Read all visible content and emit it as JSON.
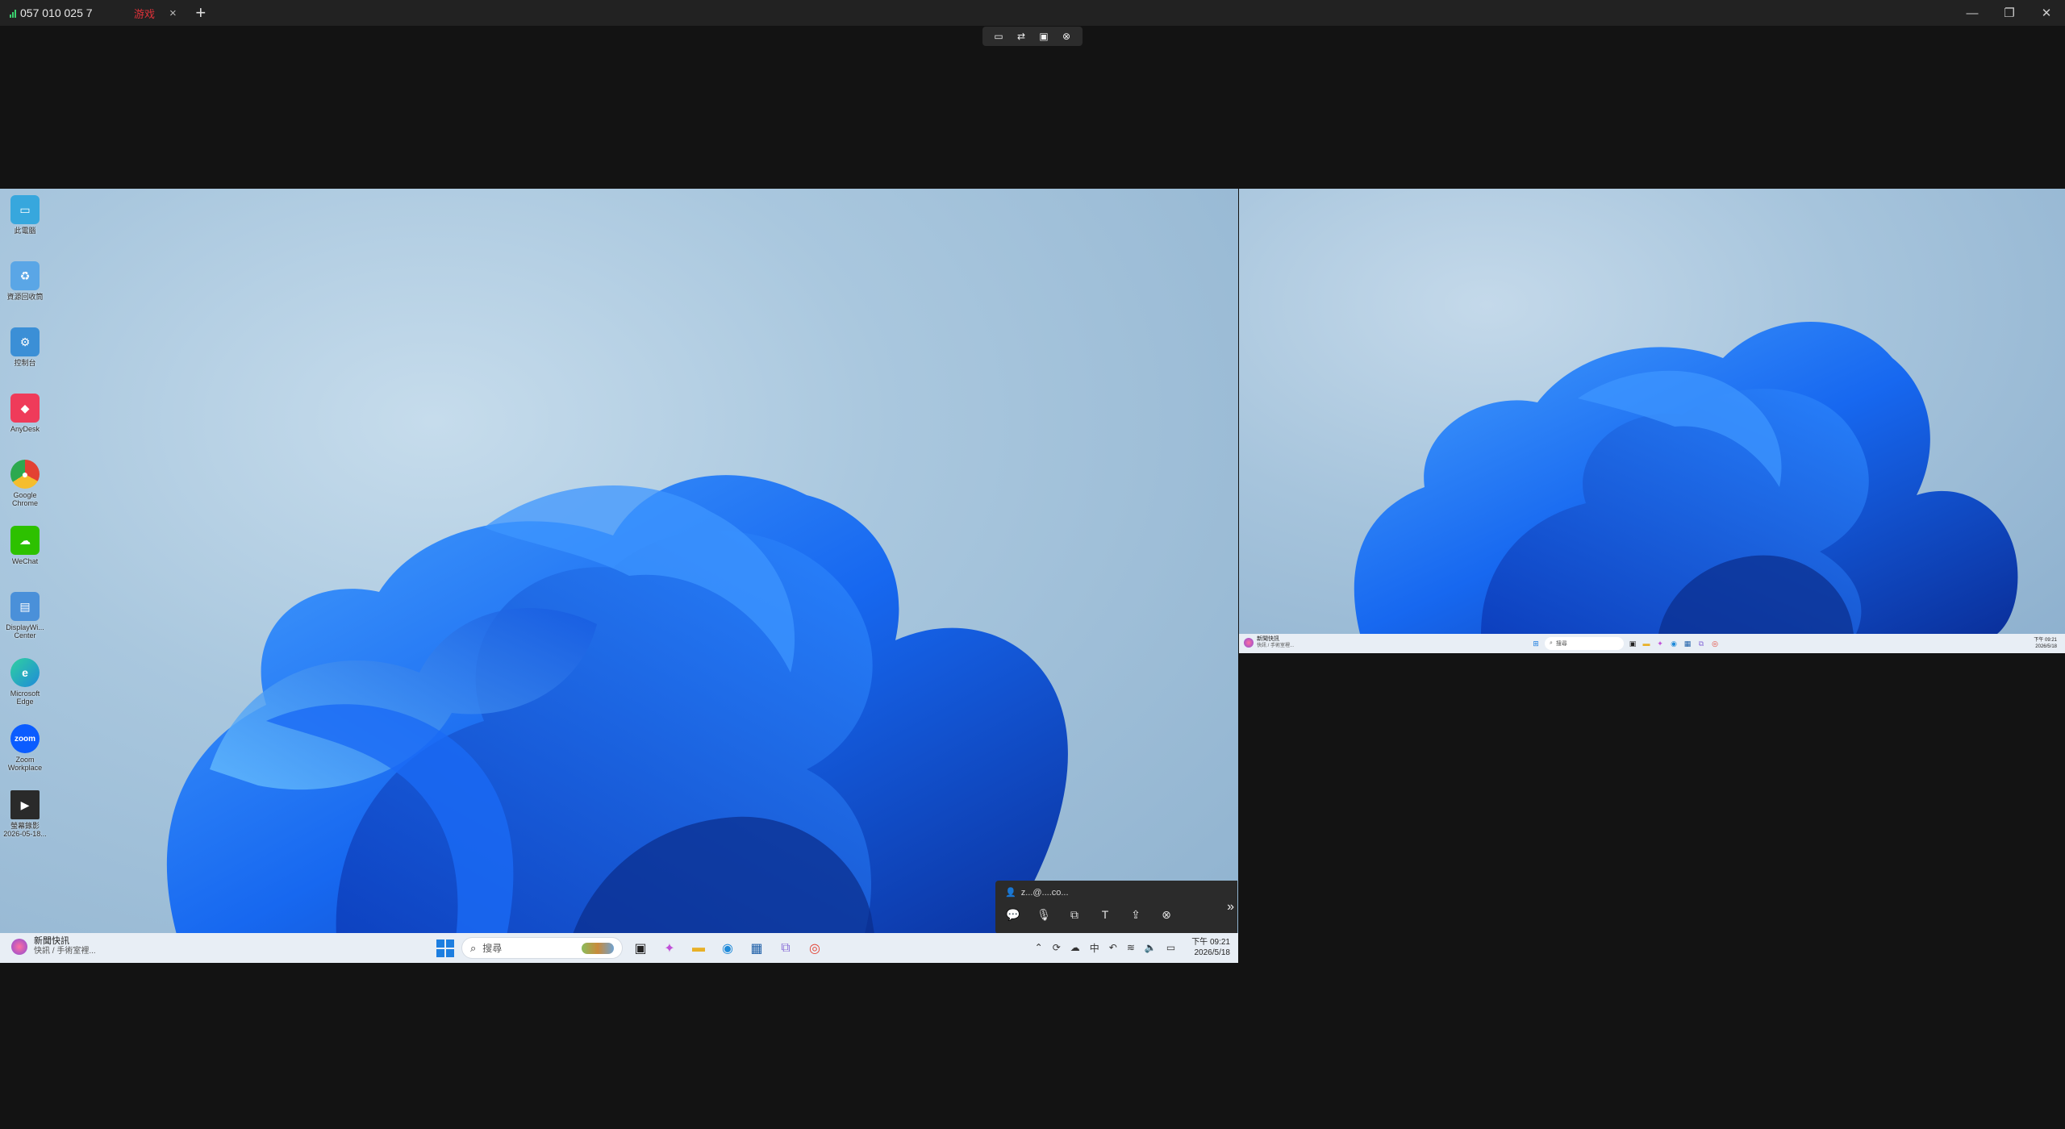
{
  "titlebar": {
    "tab_label": "057 010 025 7",
    "tab_badge": "游戏",
    "tab_close": "×",
    "new_tab": "+",
    "minimize": "—",
    "restore": "❐",
    "close": "✕"
  },
  "session_toolbar": {
    "icons": [
      "monitor-icon",
      "switch-icon",
      "display-icon",
      "close-circle-icon"
    ],
    "glyphs": [
      "▭",
      "⇄",
      "▣",
      "⊗"
    ]
  },
  "desktop_icons": [
    {
      "label": "此電腦",
      "icon": "monitor-icon",
      "color": "#37a7dd"
    },
    {
      "label": "資源回收筒",
      "icon": "recycle-bin-icon",
      "color": "#5aa6e6"
    },
    {
      "label": "控制台",
      "icon": "control-panel-icon",
      "color": "#3b8fd6"
    },
    {
      "label": "AnyDesk",
      "icon": "anydesk-icon",
      "color": "#ef3b5a"
    },
    {
      "label": "Google Chrome",
      "icon": "chrome-icon",
      "color": "#e34133"
    },
    {
      "label": "WeChat",
      "icon": "wechat-icon",
      "color": "#2dc100"
    },
    {
      "label": "DisplayWi... Center",
      "icon": "display-center-icon",
      "color": "#4a90d9"
    },
    {
      "label": "Microsoft Edge",
      "icon": "edge-icon",
      "color": "#1f8ad9"
    },
    {
      "label": "Zoom Workplace",
      "icon": "zoom-icon",
      "color": "#0b5cff"
    },
    {
      "label": "螢幕錄影 2026-05-18...",
      "icon": "video-file-icon",
      "color": "#2a2a2a"
    }
  ],
  "taskbar": {
    "news_title": "新聞快訊",
    "news_sub": "快訊 / 手術室裡...",
    "search_placeholder": "搜尋",
    "ime": "中",
    "time": "下午 09:21",
    "date": "2026/5/18"
  },
  "control_panel": {
    "user": "z...@....co...",
    "buttons": [
      "chat-icon",
      "microphone-icon",
      "screen-share-icon",
      "text-icon",
      "file-transfer-icon",
      "close-circle-icon"
    ],
    "glyphs": [
      "💬",
      "🎙",
      "⧉",
      "T",
      "⇪",
      "⊗"
    ],
    "expand": "»"
  },
  "colors": {
    "accent": "#1d7ee0",
    "tab_badge": "#e0323a",
    "signal": "#3bd16f"
  }
}
